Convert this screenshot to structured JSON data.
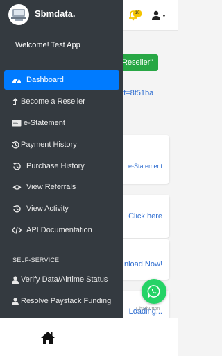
{
  "background": {
    "bell_badge": "10",
    "reseller_button_label": "Reseller\"",
    "referral_link_text": "ef=8f51ba",
    "cards": [
      {
        "text": "e-Statement"
      },
      {
        "text": "Click here"
      },
      {
        "text": "nload Now!"
      },
      {
        "text": "Loading..."
      }
    ],
    "chat_label": "Chatbutton"
  },
  "drawer": {
    "brand_name": "Sbmdata.",
    "welcome": "Welcome! Test App",
    "items": [
      {
        "label": "Dashboard",
        "icon": "dashboard-gauge-icon",
        "active": true
      },
      {
        "label": "Become a Reseller",
        "icon": "arrow-up-icon"
      },
      {
        "label": "e-Statement",
        "icon": "card-icon"
      },
      {
        "label": "Payment History",
        "icon": "history-icon"
      },
      {
        "label": "Purchase History",
        "icon": "history-icon"
      },
      {
        "label": "View Referrals",
        "icon": "eye-icon"
      },
      {
        "label": "View Activity",
        "icon": "history-icon"
      },
      {
        "label": "API Documentation",
        "icon": "code-icon"
      }
    ],
    "section_header": "SELF-SERVICE",
    "self_service_items": [
      {
        "label": "Verify Data/Airtime Status",
        "icon": "user-icon"
      },
      {
        "label": "Resolve Paystack Funding",
        "icon": "user-icon"
      }
    ]
  },
  "colors": {
    "drawer_bg": "#343a40",
    "active_item": "#007bff",
    "reseller_green": "#28a745",
    "link_blue": "#2e6dd0",
    "whatsapp_green": "#25d366"
  }
}
